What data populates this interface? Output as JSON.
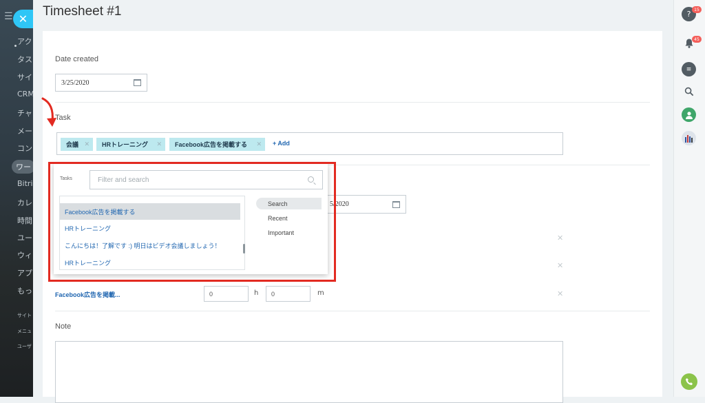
{
  "window": {
    "title": "Timesheet #1"
  },
  "sidebar": {
    "items": [
      "アク",
      "タス",
      "サイ",
      "CRM",
      "チャ",
      "メー",
      "コン",
      "ワー",
      "Bitri",
      "カレ",
      "時間",
      "ユー",
      "ウィ",
      "アプ",
      "もっ"
    ],
    "small_items": [
      "サイト",
      "メニュ",
      "ユーザ"
    ]
  },
  "form": {
    "date_created": {
      "label": "Date created",
      "value": "3/25/2020"
    },
    "task": {
      "label": "Task",
      "tags": [
        "会議",
        "HRトレーニング",
        "Facebook広告を掲載する"
      ],
      "add_label": "+ Add"
    },
    "second_date": {
      "value": "5/2020"
    },
    "row": {
      "link": "Facebook広告を掲載...",
      "hours": "0",
      "hours_unit": "h",
      "minutes": "0",
      "minutes_unit": "m"
    },
    "note": {
      "label": "Note"
    }
  },
  "popup": {
    "label": "Tasks",
    "search_placeholder": "Filter and search",
    "items": [
      "Facebook広告を掲載する",
      "HRトレーニング",
      "こんにちは！了解です :) 明日はビデオ会議しましょう！",
      "HRトレーニング"
    ],
    "filters": [
      "Search",
      "Recent",
      "Important"
    ]
  },
  "rightbar": {
    "help_badge": "15",
    "notifications_badge": "45"
  },
  "colors": {
    "accent": "#2fc6f6",
    "tag": "#bde9ef",
    "highlight": "#e22a21",
    "link": "#2066b0",
    "phone": "#8bc34a"
  }
}
